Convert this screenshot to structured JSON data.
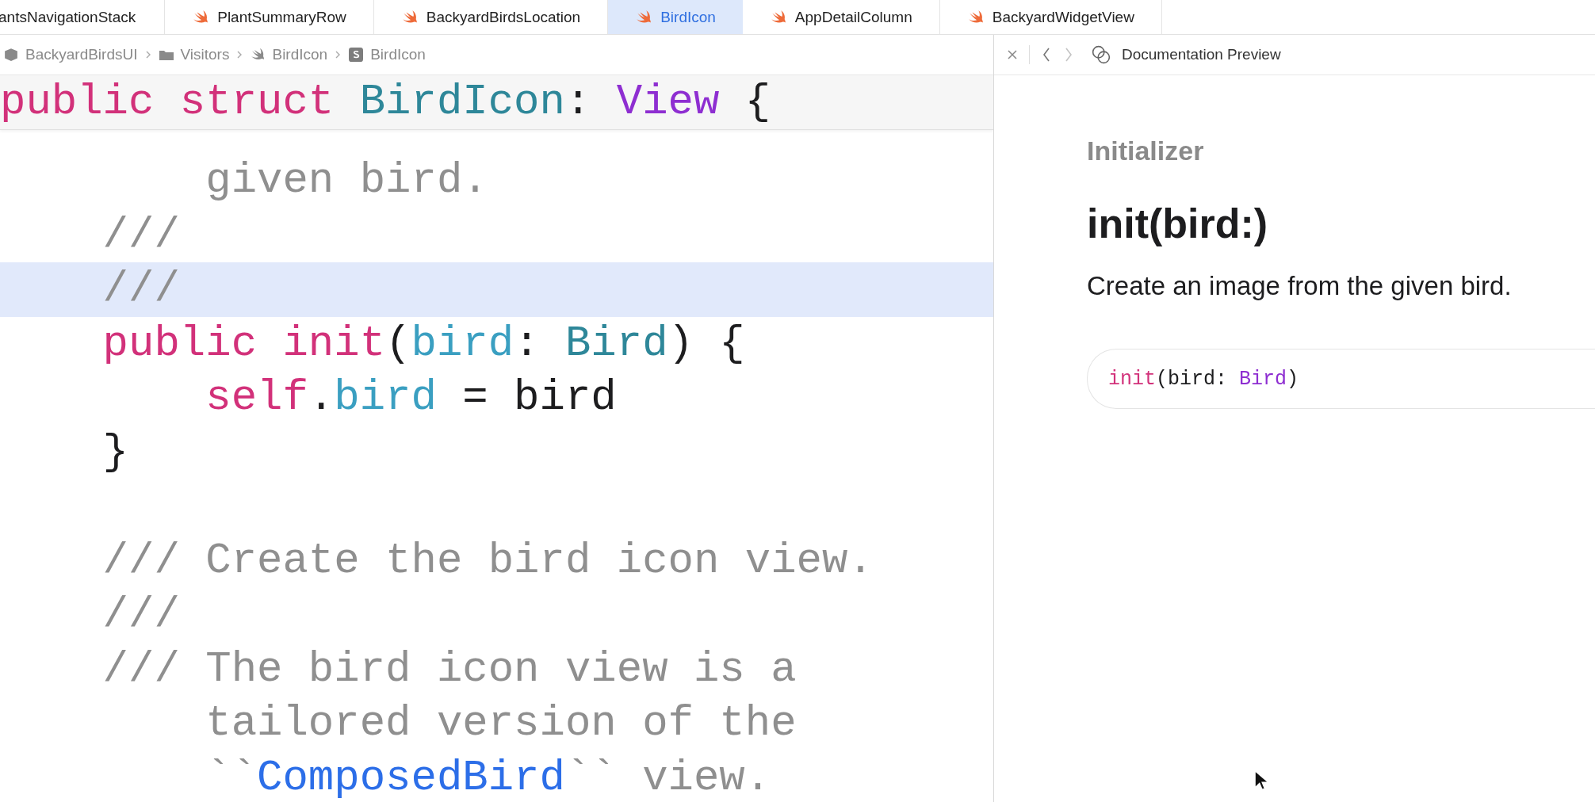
{
  "tabs": [
    {
      "label": "antsNavigationStack",
      "selected": false
    },
    {
      "label": "PlantSummaryRow",
      "selected": false
    },
    {
      "label": "BackyardBirdsLocation",
      "selected": false
    },
    {
      "label": "BirdIcon",
      "selected": true
    },
    {
      "label": "AppDetailColumn",
      "selected": false
    },
    {
      "label": "BackyardWidgetView",
      "selected": false
    }
  ],
  "breadcrumb": [
    {
      "label": "BackyardBirdsUI",
      "kind": "package"
    },
    {
      "label": "Visitors",
      "kind": "folder"
    },
    {
      "label": "BirdIcon",
      "kind": "swift"
    },
    {
      "label": "BirdIcon",
      "kind": "struct"
    }
  ],
  "editor": {
    "sticky_header": [
      {
        "text": "public ",
        "kind": "keyword"
      },
      {
        "text": "struct ",
        "kind": "keyword"
      },
      {
        "text": "BirdIcon",
        "kind": "type"
      },
      {
        "text": ": ",
        "kind": "plain"
      },
      {
        "text": "View",
        "kind": "protocol"
      },
      {
        "text": " {",
        "kind": "plain"
      }
    ],
    "lines": [
      {
        "highlighted": false,
        "tokens": [
          {
            "text": "        given bird.",
            "kind": "comment"
          }
        ]
      },
      {
        "highlighted": false,
        "tokens": [
          {
            "text": "    ///",
            "kind": "comment"
          }
        ]
      },
      {
        "highlighted": true,
        "tokens": [
          {
            "text": "    ///",
            "kind": "comment"
          }
        ]
      },
      {
        "highlighted": false,
        "tokens": [
          {
            "text": "    public ",
            "kind": "keyword"
          },
          {
            "text": "init",
            "kind": "keyword"
          },
          {
            "text": "(",
            "kind": "plain"
          },
          {
            "text": "bird",
            "kind": "property"
          },
          {
            "text": ": ",
            "kind": "plain"
          },
          {
            "text": "Bird",
            "kind": "type"
          },
          {
            "text": ") {",
            "kind": "plain"
          }
        ]
      },
      {
        "highlighted": false,
        "tokens": [
          {
            "text": "        self",
            "kind": "keyword"
          },
          {
            "text": ".",
            "kind": "plain"
          },
          {
            "text": "bird",
            "kind": "property"
          },
          {
            "text": " = bird",
            "kind": "plain"
          }
        ]
      },
      {
        "highlighted": false,
        "tokens": [
          {
            "text": "    }",
            "kind": "plain"
          }
        ]
      },
      {
        "highlighted": false
      },
      {
        "highlighted": false,
        "tokens": [
          {
            "text": "    /// Create the bird icon view.",
            "kind": "comment"
          }
        ]
      },
      {
        "highlighted": false,
        "tokens": [
          {
            "text": "    ///",
            "kind": "comment"
          }
        ]
      },
      {
        "highlighted": false,
        "tokens": [
          {
            "text": "    /// The bird icon view is a",
            "kind": "comment"
          }
        ]
      },
      {
        "highlighted": false,
        "tokens": [
          {
            "text": "        tailored version of the",
            "kind": "comment"
          }
        ]
      },
      {
        "highlighted": false,
        "tokens": [
          {
            "text": "        ``",
            "kind": "comment"
          },
          {
            "text": "ComposedBird",
            "kind": "doclink"
          },
          {
            "text": "`` view.",
            "kind": "comment"
          }
        ]
      }
    ]
  },
  "doc_preview": {
    "back_disabled": false,
    "forward_disabled": true,
    "title": "Documentation Preview",
    "eyebrow": "Initializer",
    "heading": "init(bird:)",
    "abstract": "Create an image from the given bird.",
    "declaration": [
      {
        "text": "init",
        "kind": "keyword"
      },
      {
        "text": "(bird: ",
        "kind": "plain"
      },
      {
        "text": "Bird",
        "kind": "protocol"
      },
      {
        "text": ")",
        "kind": "plain"
      }
    ]
  }
}
